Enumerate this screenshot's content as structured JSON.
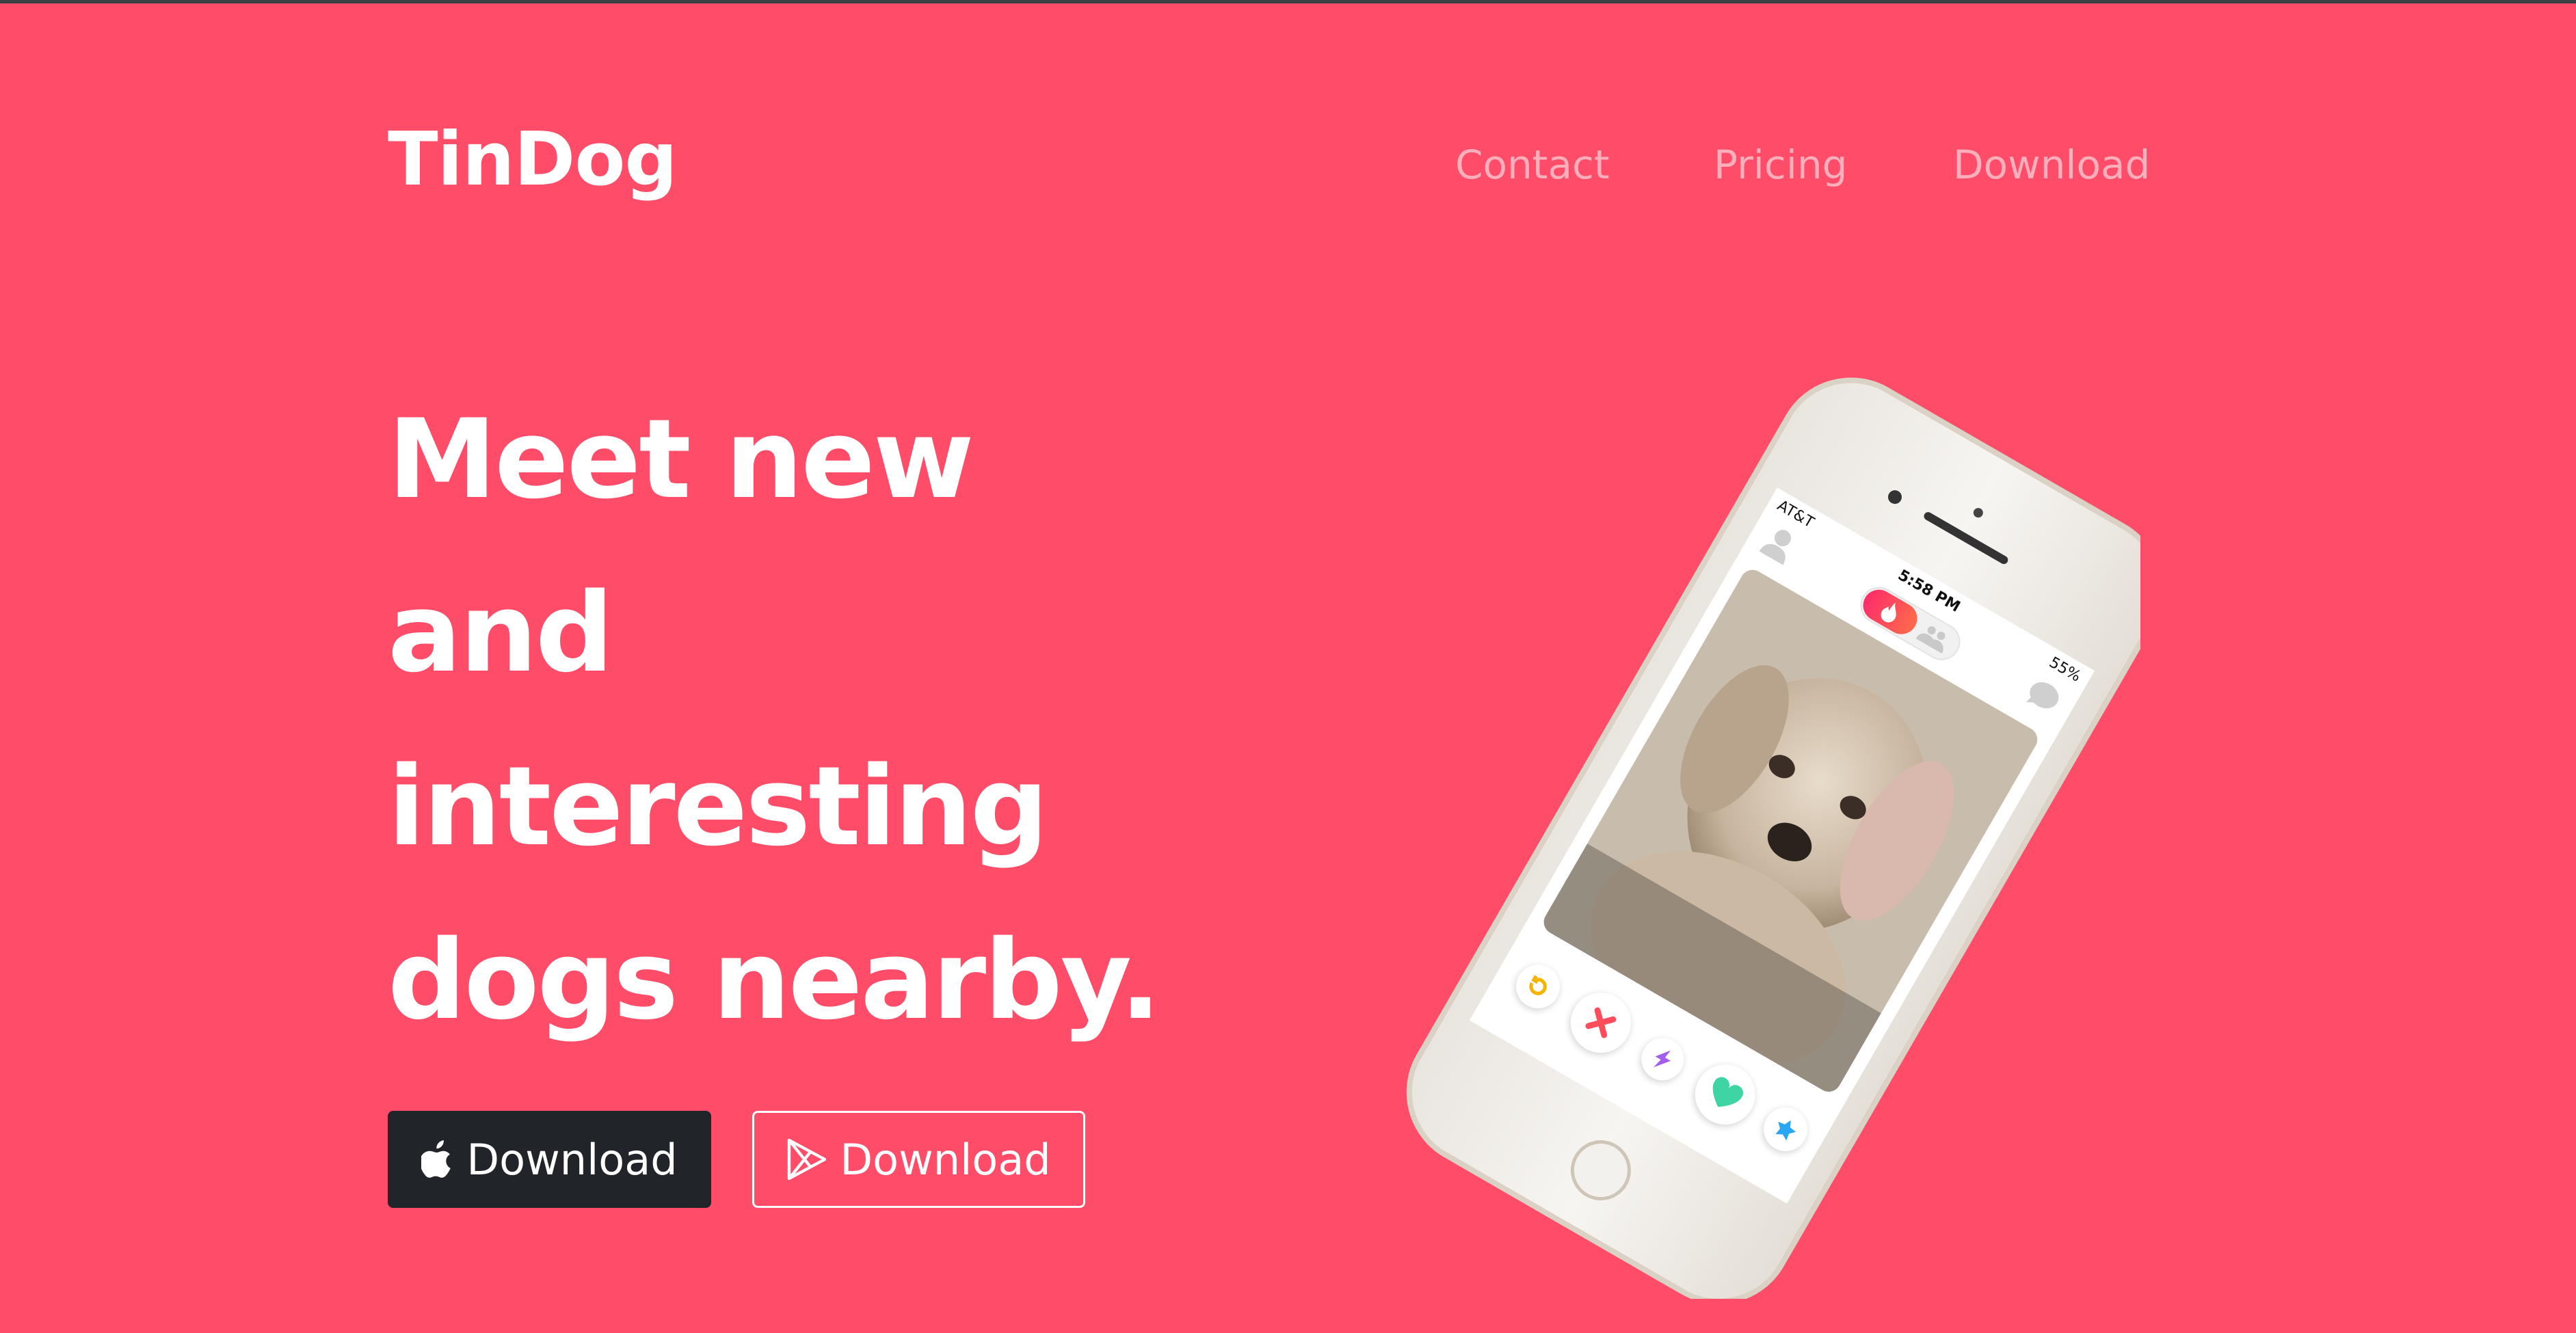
{
  "header": {
    "brand": "TinDog",
    "nav": [
      {
        "label": "Contact"
      },
      {
        "label": "Pricing"
      },
      {
        "label": "Download"
      }
    ]
  },
  "hero": {
    "title_lines": [
      "Meet new",
      "and",
      "interesting",
      "dogs nearby."
    ],
    "buttons": {
      "apple_label": "Download",
      "play_label": "Download"
    }
  },
  "phone": {
    "carrier": "AT&T",
    "time": "5:58 PM",
    "battery": "55%",
    "icons": [
      "profile-icon",
      "flame-icon",
      "groups-icon",
      "chat-icon",
      "rewind-icon",
      "nope-icon",
      "boost-icon",
      "like-icon",
      "super-like-icon"
    ]
  },
  "colors": {
    "background": "#ff4c68",
    "dark_button": "#212529",
    "text": "#ffffff"
  }
}
